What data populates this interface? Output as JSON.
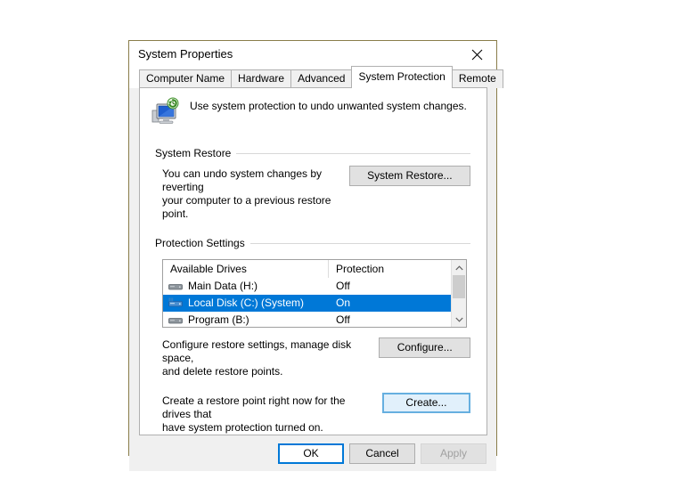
{
  "window": {
    "title": "System Properties",
    "close_icon": "close-icon"
  },
  "tabs": [
    {
      "label": "Computer Name",
      "active": false
    },
    {
      "label": "Hardware",
      "active": false
    },
    {
      "label": "Advanced",
      "active": false
    },
    {
      "label": "System Protection",
      "active": true
    },
    {
      "label": "Remote",
      "active": false
    }
  ],
  "page": {
    "icon": "system-protection-icon",
    "description": "Use system protection to undo unwanted system changes."
  },
  "system_restore": {
    "group_title": "System Restore",
    "description_line1": "You can undo system changes by reverting",
    "description_line2": "your computer to a previous restore point.",
    "button_label": "System Restore..."
  },
  "protection_settings": {
    "group_title": "Protection Settings",
    "columns": [
      "Available Drives",
      "Protection"
    ],
    "rows": [
      {
        "icon": "hard-drive-icon",
        "drive": "Main Data (H:)",
        "protection": "Off",
        "selected": false
      },
      {
        "icon": "system-drive-icon",
        "drive": "Local Disk (C:) (System)",
        "protection": "On",
        "selected": true
      },
      {
        "icon": "hard-drive-icon",
        "drive": "Program (B:)",
        "protection": "Off",
        "selected": false
      }
    ],
    "scroll_up_icon": "chevron-up-icon",
    "scroll_down_icon": "chevron-down-icon",
    "configure": {
      "description_line1": "Configure restore settings, manage disk space,",
      "description_line2": "and delete restore points.",
      "button_label": "Configure..."
    },
    "create": {
      "description_line1": "Create a restore point right now for the drives that",
      "description_line2": "have system protection turned on.",
      "button_label": "Create..."
    }
  },
  "footer": {
    "ok_label": "OK",
    "cancel_label": "Cancel",
    "apply_label": "Apply"
  },
  "colors": {
    "selection_blue": "#0078d7",
    "focus_blue": "#66afe0",
    "dialog_border": "#8a7d4a",
    "dialog_bg": "#f0f0f0"
  }
}
